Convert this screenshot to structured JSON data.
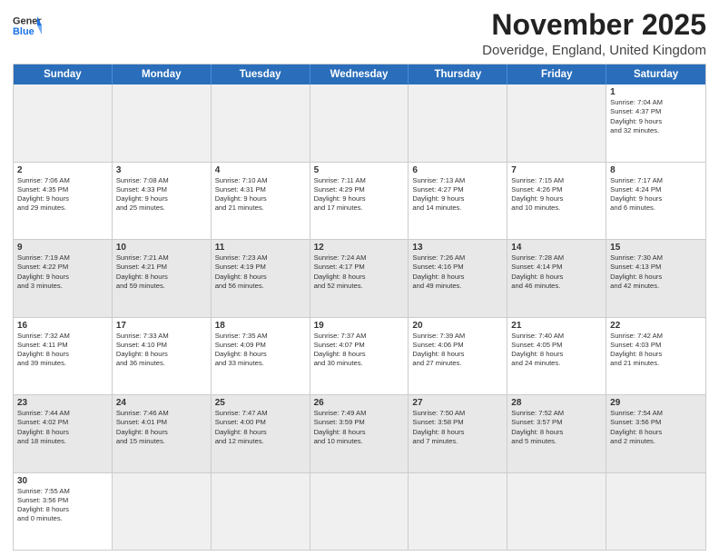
{
  "header": {
    "logo_general": "General",
    "logo_blue": "Blue",
    "month_title": "November 2025",
    "location": "Doveridge, England, United Kingdom"
  },
  "day_headers": [
    "Sunday",
    "Monday",
    "Tuesday",
    "Wednesday",
    "Thursday",
    "Friday",
    "Saturday"
  ],
  "weeks": [
    [
      {
        "day": "",
        "info": "",
        "empty": true
      },
      {
        "day": "",
        "info": "",
        "empty": true
      },
      {
        "day": "",
        "info": "",
        "empty": true
      },
      {
        "day": "",
        "info": "",
        "empty": true
      },
      {
        "day": "",
        "info": "",
        "empty": true
      },
      {
        "day": "",
        "info": "",
        "empty": true
      },
      {
        "day": "1",
        "info": "Sunrise: 7:04 AM\nSunset: 4:37 PM\nDaylight: 9 hours\nand 32 minutes."
      }
    ],
    [
      {
        "day": "2",
        "info": "Sunrise: 7:06 AM\nSunset: 4:35 PM\nDaylight: 9 hours\nand 29 minutes."
      },
      {
        "day": "3",
        "info": "Sunrise: 7:08 AM\nSunset: 4:33 PM\nDaylight: 9 hours\nand 25 minutes."
      },
      {
        "day": "4",
        "info": "Sunrise: 7:10 AM\nSunset: 4:31 PM\nDaylight: 9 hours\nand 21 minutes."
      },
      {
        "day": "5",
        "info": "Sunrise: 7:11 AM\nSunset: 4:29 PM\nDaylight: 9 hours\nand 17 minutes."
      },
      {
        "day": "6",
        "info": "Sunrise: 7:13 AM\nSunset: 4:27 PM\nDaylight: 9 hours\nand 14 minutes."
      },
      {
        "day": "7",
        "info": "Sunrise: 7:15 AM\nSunset: 4:26 PM\nDaylight: 9 hours\nand 10 minutes."
      },
      {
        "day": "8",
        "info": "Sunrise: 7:17 AM\nSunset: 4:24 PM\nDaylight: 9 hours\nand 6 minutes."
      }
    ],
    [
      {
        "day": "9",
        "info": "Sunrise: 7:19 AM\nSunset: 4:22 PM\nDaylight: 9 hours\nand 3 minutes.",
        "shaded": true
      },
      {
        "day": "10",
        "info": "Sunrise: 7:21 AM\nSunset: 4:21 PM\nDaylight: 8 hours\nand 59 minutes.",
        "shaded": true
      },
      {
        "day": "11",
        "info": "Sunrise: 7:23 AM\nSunset: 4:19 PM\nDaylight: 8 hours\nand 56 minutes.",
        "shaded": true
      },
      {
        "day": "12",
        "info": "Sunrise: 7:24 AM\nSunset: 4:17 PM\nDaylight: 8 hours\nand 52 minutes.",
        "shaded": true
      },
      {
        "day": "13",
        "info": "Sunrise: 7:26 AM\nSunset: 4:16 PM\nDaylight: 8 hours\nand 49 minutes.",
        "shaded": true
      },
      {
        "day": "14",
        "info": "Sunrise: 7:28 AM\nSunset: 4:14 PM\nDaylight: 8 hours\nand 46 minutes.",
        "shaded": true
      },
      {
        "day": "15",
        "info": "Sunrise: 7:30 AM\nSunset: 4:13 PM\nDaylight: 8 hours\nand 42 minutes.",
        "shaded": true
      }
    ],
    [
      {
        "day": "16",
        "info": "Sunrise: 7:32 AM\nSunset: 4:11 PM\nDaylight: 8 hours\nand 39 minutes."
      },
      {
        "day": "17",
        "info": "Sunrise: 7:33 AM\nSunset: 4:10 PM\nDaylight: 8 hours\nand 36 minutes."
      },
      {
        "day": "18",
        "info": "Sunrise: 7:35 AM\nSunset: 4:09 PM\nDaylight: 8 hours\nand 33 minutes."
      },
      {
        "day": "19",
        "info": "Sunrise: 7:37 AM\nSunset: 4:07 PM\nDaylight: 8 hours\nand 30 minutes."
      },
      {
        "day": "20",
        "info": "Sunrise: 7:39 AM\nSunset: 4:06 PM\nDaylight: 8 hours\nand 27 minutes."
      },
      {
        "day": "21",
        "info": "Sunrise: 7:40 AM\nSunset: 4:05 PM\nDaylight: 8 hours\nand 24 minutes."
      },
      {
        "day": "22",
        "info": "Sunrise: 7:42 AM\nSunset: 4:03 PM\nDaylight: 8 hours\nand 21 minutes."
      }
    ],
    [
      {
        "day": "23",
        "info": "Sunrise: 7:44 AM\nSunset: 4:02 PM\nDaylight: 8 hours\nand 18 minutes.",
        "shaded": true
      },
      {
        "day": "24",
        "info": "Sunrise: 7:46 AM\nSunset: 4:01 PM\nDaylight: 8 hours\nand 15 minutes.",
        "shaded": true
      },
      {
        "day": "25",
        "info": "Sunrise: 7:47 AM\nSunset: 4:00 PM\nDaylight: 8 hours\nand 12 minutes.",
        "shaded": true
      },
      {
        "day": "26",
        "info": "Sunrise: 7:49 AM\nSunset: 3:59 PM\nDaylight: 8 hours\nand 10 minutes.",
        "shaded": true
      },
      {
        "day": "27",
        "info": "Sunrise: 7:50 AM\nSunset: 3:58 PM\nDaylight: 8 hours\nand 7 minutes.",
        "shaded": true
      },
      {
        "day": "28",
        "info": "Sunrise: 7:52 AM\nSunset: 3:57 PM\nDaylight: 8 hours\nand 5 minutes.",
        "shaded": true
      },
      {
        "day": "29",
        "info": "Sunrise: 7:54 AM\nSunset: 3:56 PM\nDaylight: 8 hours\nand 2 minutes.",
        "shaded": true
      }
    ],
    [
      {
        "day": "30",
        "info": "Sunrise: 7:55 AM\nSunset: 3:56 PM\nDaylight: 8 hours\nand 0 minutes."
      },
      {
        "day": "",
        "info": "",
        "empty": true
      },
      {
        "day": "",
        "info": "",
        "empty": true
      },
      {
        "day": "",
        "info": "",
        "empty": true
      },
      {
        "day": "",
        "info": "",
        "empty": true
      },
      {
        "day": "",
        "info": "",
        "empty": true
      },
      {
        "day": "",
        "info": "",
        "empty": true
      }
    ]
  ]
}
